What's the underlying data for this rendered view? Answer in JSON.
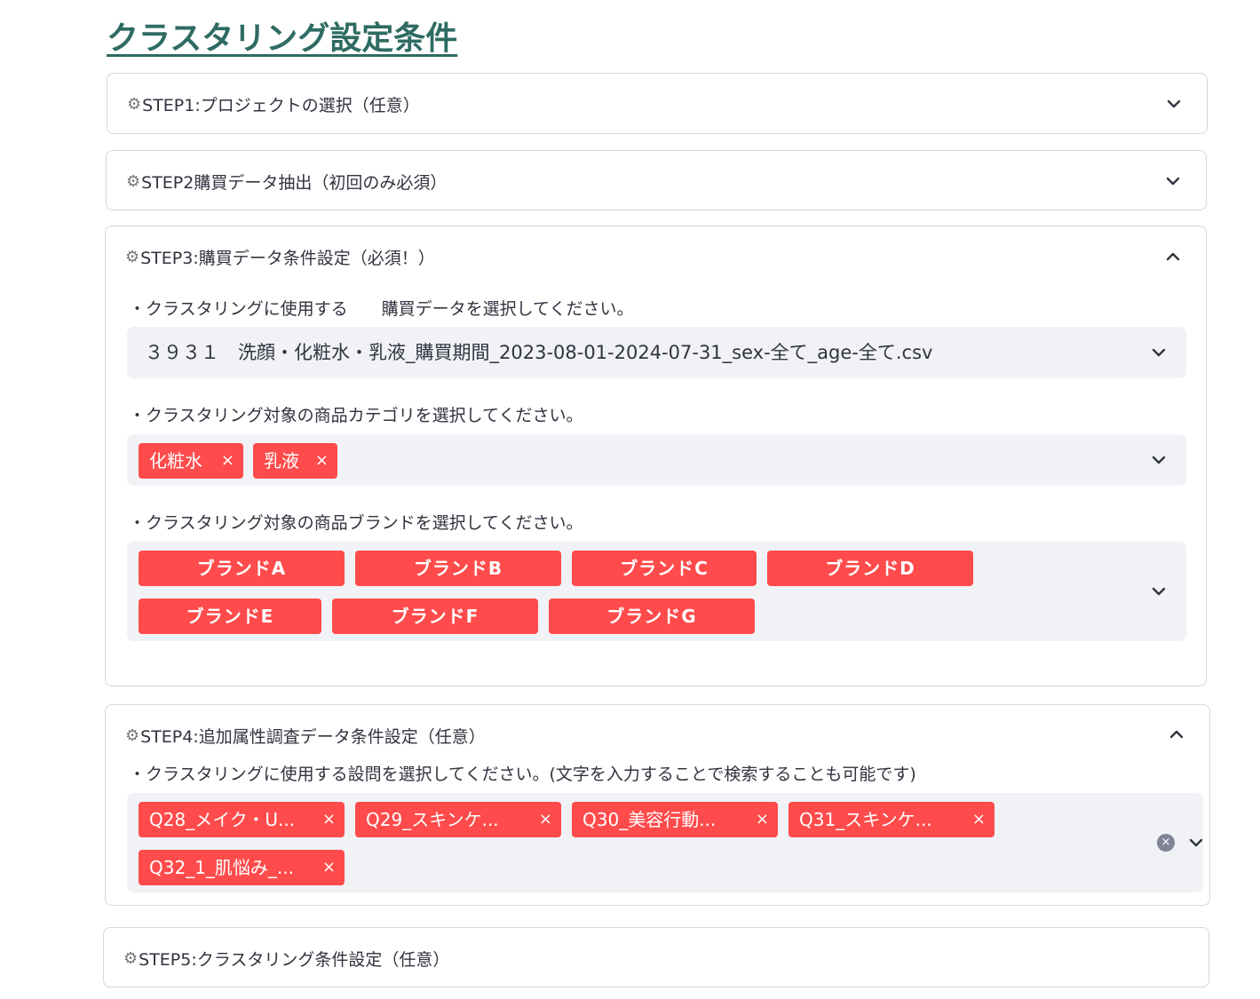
{
  "title": "クラスタリング設定条件",
  "steps": [
    {
      "icon": "gear-icon",
      "label": "STEP1:プロジェクトの選択（任意）",
      "expanded": false
    },
    {
      "icon": "gear-icon",
      "label": "STEP2購買データ抽出（初回のみ必須）",
      "expanded": false
    },
    {
      "icon": "gear-icon",
      "label": "STEP3:購買データ条件設定（必須！）",
      "expanded": true
    },
    {
      "icon": "gear-icon",
      "label": "STEP4:追加属性調査データ条件設定（任意）",
      "expanded": true
    },
    {
      "icon": "gear-icon",
      "label": "STEP5:クラスタリング条件設定（任意）",
      "expanded": false
    }
  ],
  "step3": {
    "data_label": "・クラスタリングに使用する　　購買データを選択してください。",
    "data_value": "３９３１　洗顔・化粧水・乳液_購買期間_2023-08-01-2024-07-31_sex-全て_age-全て.csv",
    "category_label": "・クラスタリング対象の商品カテゴリを選択してください。",
    "categories": [
      "化粧水",
      "乳液"
    ],
    "brand_label": "・クラスタリング対象の商品ブランドを選択してください。",
    "brands": [
      "ブランドA",
      "ブランドB",
      "ブランドC",
      "ブランドD",
      "ブランドE",
      "ブランドF",
      "ブランドG"
    ]
  },
  "step4": {
    "question_label": "・クラスタリングに使用する設問を選択してください。(文字を入力することで検索することも可能です)",
    "questions": [
      "Q28_メイク・U...",
      "Q29_スキンケ...",
      "Q30_美容行動...",
      "Q31_スキンケ...",
      "Q32_1_肌悩み_..."
    ]
  },
  "icons": {
    "remove": "×",
    "clear": "×",
    "gear": "⚙"
  },
  "colors": {
    "tag": "#ff4b4b",
    "title": "#2e6b63",
    "select_bg": "#f0f2f6"
  }
}
